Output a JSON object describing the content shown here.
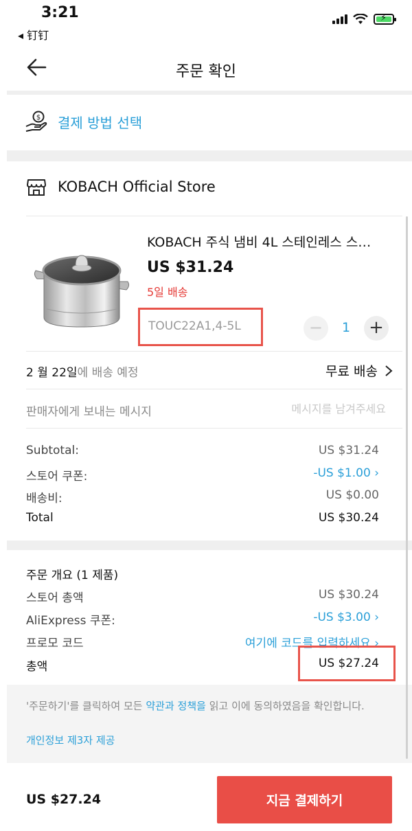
{
  "status_bar": {
    "time": "3:21",
    "back_app": "◂ 钉钉"
  },
  "header": {
    "title": "주문 확인"
  },
  "payment": {
    "label": "결제 방법 선택"
  },
  "store": {
    "name": "KOBACH Official Store"
  },
  "product": {
    "title": "KOBACH 주식 냄비 4L 스테인레스 스…",
    "price": "US $31.24",
    "shipping_days": "5일 배송",
    "sku": "TOUC22A1,4-5L",
    "quantity": "1",
    "qty_minus": "−",
    "qty_plus": "+"
  },
  "delivery": {
    "date": "2 월 22일",
    "date_suffix": "에 배송 예정",
    "method": "무료 배송"
  },
  "message": {
    "label": "판매자에게 보내는 메시지",
    "placeholder": "메시지를 남겨주세요"
  },
  "store_summary": {
    "subtotal_label": "Subtotal:",
    "subtotal_value": "US $31.24",
    "coupon_label": "스토어 쿠폰:",
    "coupon_value": "-US $1.00",
    "shipping_label": "배송비:",
    "shipping_value": "US $0.00",
    "total_label": "Total",
    "total_value": "US $30.24"
  },
  "order_summary": {
    "heading": "주문 개요 (1 제품)",
    "store_total_label": "스토어 총액",
    "store_total_value": "US $30.24",
    "ali_coupon_label": "AliExpress 쿠폰:",
    "ali_coupon_value": "-US $3.00",
    "promo_label": "프로모 코드",
    "promo_value": "여기에 코드를 입력하세요",
    "grand_total_label": "총액",
    "grand_total_value": "US $27.24"
  },
  "terms": {
    "text_before": "'주문하기'를 클릭하여 모든 ",
    "link": "약관과 정책을",
    "text_after": " 읽고 이에 동의하였음을 확인합니다.",
    "privacy_link": "개인정보 제3자 제공"
  },
  "bottom_bar": {
    "total": "US $27.24",
    "pay_button": "지금 결제하기"
  },
  "colors": {
    "accent_blue": "#2a9fd8",
    "accent_red": "#e94e47",
    "highlight_box": "#e8534a"
  }
}
